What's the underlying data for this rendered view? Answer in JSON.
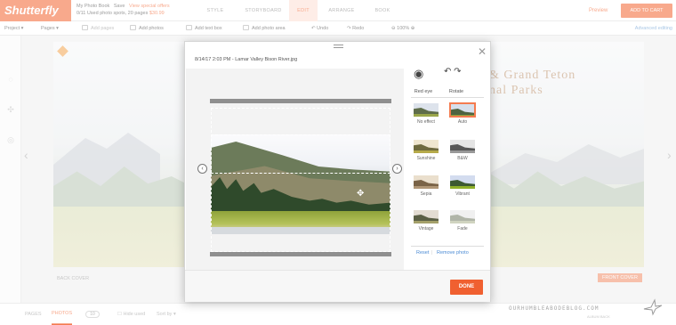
{
  "app": {
    "logo": "Shutterfly",
    "book_title": "My Photo Book",
    "book_save": "Save",
    "book_offer": "View special offers",
    "book_meta": "0/11 Used photo spots, 20 pages",
    "book_price": "$30.99",
    "nav_tabs": [
      "STYLE",
      "STORYBOARD",
      "EDIT",
      "ARRANGE",
      "BOOK"
    ],
    "active_tab": "EDIT",
    "preview": "Preview",
    "add_to_cart": "ADD TO CART"
  },
  "toolbar": {
    "project": "Project",
    "pages": "Pages",
    "add_pages": "Add pages",
    "add_photos": "Add photos",
    "add_text_box": "Add text box",
    "add_photo_area": "Add photo area",
    "undo": "Undo",
    "redo": "Redo",
    "zoom": "100%",
    "advanced_editing": "Advanced editing"
  },
  "canvas": {
    "cover_title_line1": "& Grand Teton",
    "cover_title_line2": "nal Parks",
    "back_cover": "BACK COVER",
    "front_cover": "FRONT COVER"
  },
  "bottom": {
    "pages_tab": "PAGES",
    "photos_tab": "PHOTOS",
    "photo_count": "10",
    "hide_used": "Hide used",
    "sort_by": "Sort by",
    "watermark": "OURHUMBLEABODEBLOG.COM",
    "watermark_sub": "ALBUM BACK"
  },
  "modal": {
    "filename": "8/14/17 2:03 PM - Lamar Valley Bison River.jpg",
    "tools": [
      {
        "label": "Red eye",
        "icon": "eye-icon"
      },
      {
        "label": "Rotate",
        "icon": "rotate-icon"
      }
    ],
    "filters": [
      {
        "label": "No effect",
        "sky": "#dde3ec",
        "land": "#5f6d4a",
        "grass": "#9aa64a"
      },
      {
        "label": "Auto",
        "sky": "#d7dfeb",
        "land": "#4f6340",
        "grass": "#8ba03a",
        "selected": true
      },
      {
        "label": "Sunshine",
        "sky": "#efe6cf",
        "land": "#6e6a3e",
        "grass": "#b6aa4a"
      },
      {
        "label": "B&W",
        "sky": "#e4e4e4",
        "land": "#555555",
        "grass": "#999999"
      },
      {
        "label": "Sepia",
        "sky": "#eadfcd",
        "land": "#7a6347",
        "grass": "#b09676"
      },
      {
        "label": "Vibrant",
        "sky": "#d3dcef",
        "land": "#3c5a32",
        "grass": "#8fb02a"
      },
      {
        "label": "Vintage",
        "sky": "#e3dcd2",
        "land": "#5a5f45",
        "grass": "#a4a06a"
      },
      {
        "label": "Fade",
        "sky": "#f0f0f0",
        "land": "#b0b5a8",
        "grass": "#d0d4c0"
      }
    ],
    "reset": "Reset",
    "remove_photo": "Remove photo",
    "done": "DONE"
  }
}
